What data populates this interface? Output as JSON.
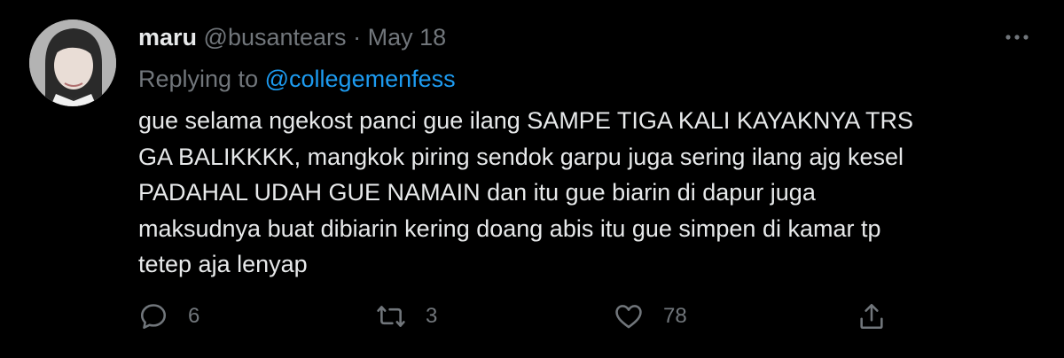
{
  "user": {
    "name": "maru",
    "handle": "@busantears",
    "separator": "·",
    "date": "May 18"
  },
  "reply": {
    "prefix": "Replying to",
    "mention": "@collegemenfess"
  },
  "body_lines": [
    "gue selama ngekost panci gue ilang SAMPE TIGA KALI KAYAKNYA TRS",
    "GA BALIKKKK, mangkok piring sendok garpu juga sering ilang ajg kesel",
    "PADAHAL UDAH GUE NAMAIN dan itu gue biarin di dapur juga",
    "maksudnya buat dibiarin kering doang abis itu gue simpen di kamar tp",
    "tetep aja lenyap"
  ],
  "actions": {
    "reply_count": "6",
    "retweet_count": "3",
    "like_count": "78"
  },
  "icons": [
    "avatar",
    "more-icon",
    "reply-icon",
    "retweet-icon",
    "like-icon",
    "share-icon"
  ],
  "colors": {
    "background": "#000000",
    "text": "#e7e9ea",
    "secondary": "#71767b",
    "link": "#1d9bf0"
  }
}
